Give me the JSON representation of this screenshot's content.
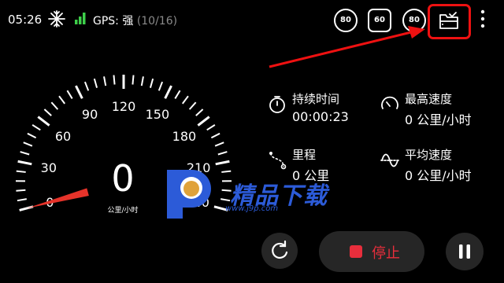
{
  "status_bar": {
    "time": "05:26",
    "gps_label": "GPS: 强",
    "gps_count": "(10/16)",
    "icons": [
      "snowflake-icon",
      "signal-bars-icon"
    ]
  },
  "speed_limits": [
    "80",
    "60",
    "80"
  ],
  "toolbar_icons": [
    "export-icon",
    "more-vertical-icon"
  ],
  "colors": {
    "accent_red": "#e82e3c",
    "gauge_needle": "#e6332a",
    "button_bg": "#262626"
  },
  "gauge": {
    "tick_labels": [
      "0",
      "30",
      "60",
      "90",
      "120",
      "150",
      "180",
      "210",
      "240"
    ],
    "speed": "0",
    "unit": "公里/小时"
  },
  "stats": {
    "duration": {
      "label": "持续时间",
      "value": "00:00:23",
      "icon": "stopwatch-icon"
    },
    "max_speed": {
      "label": "最高速度",
      "value": "0 公里/小时",
      "icon": "speedometer-icon"
    },
    "distance": {
      "label": "里程",
      "value": "0 公里",
      "icon": "route-icon"
    },
    "avg_speed": {
      "label": "平均速度",
      "value": "0 公里/小时",
      "icon": "wave-icon"
    }
  },
  "controls": {
    "reset_icon": "refresh-icon",
    "stop_label": "停止",
    "pause_icon": "pause-icon"
  },
  "watermark": {
    "text": "精品下载",
    "url": "www.j9p.com"
  }
}
